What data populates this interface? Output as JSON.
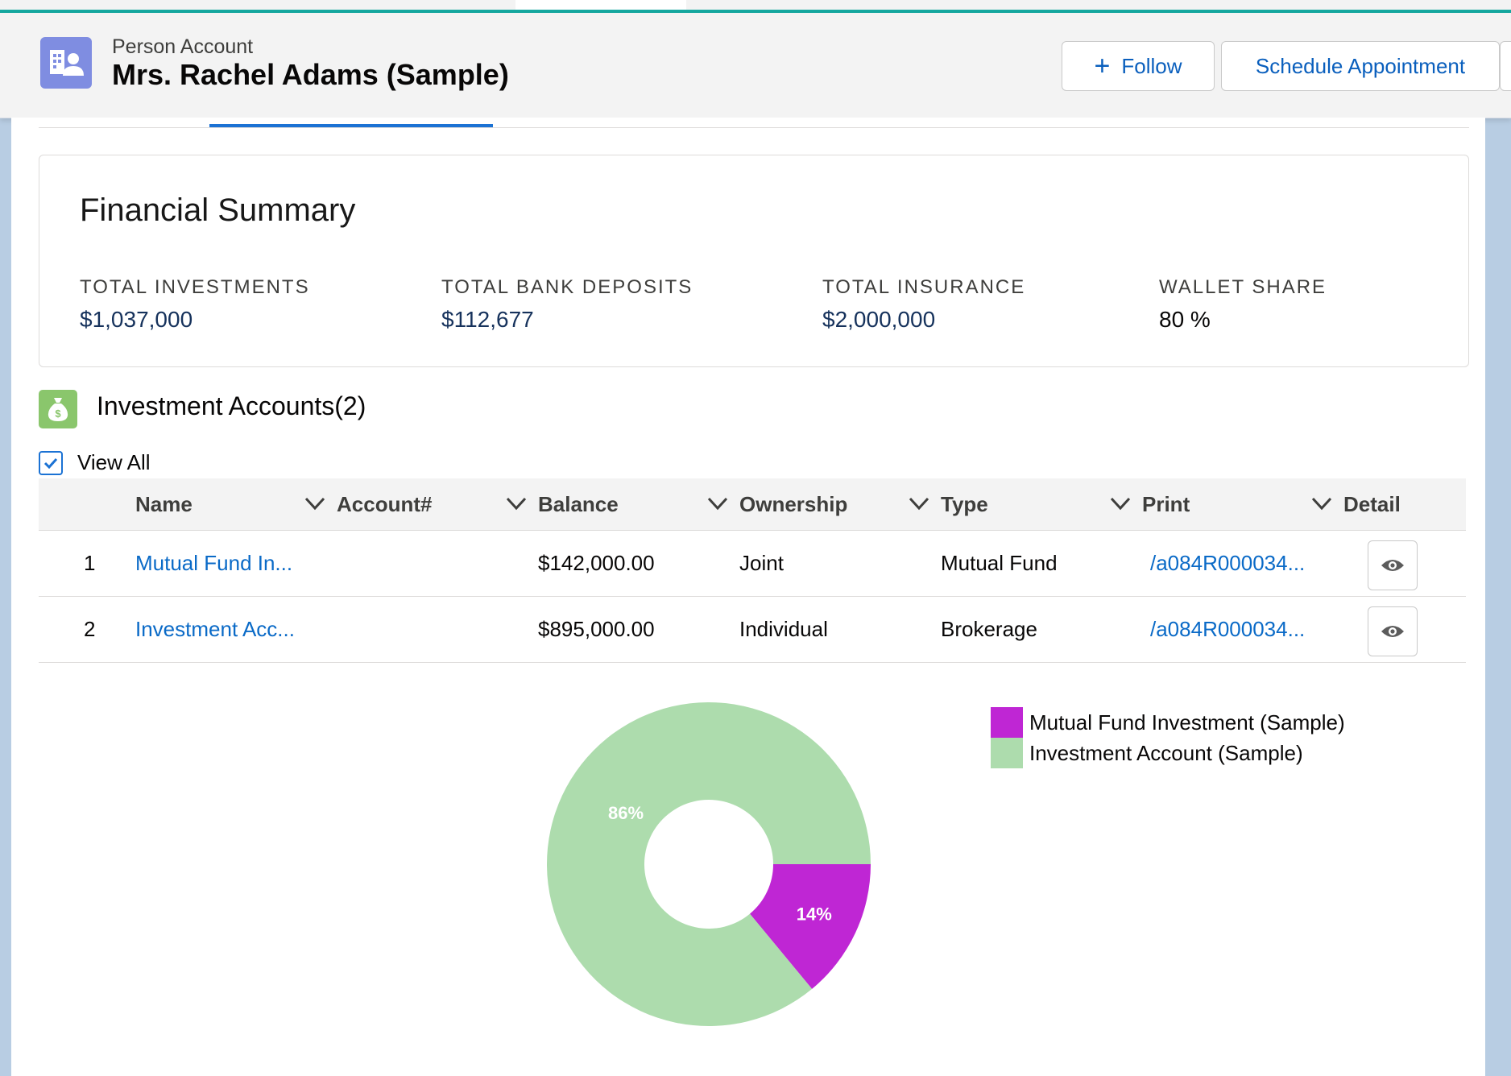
{
  "header": {
    "object_type": "Person Account",
    "record_name": "Mrs. Rachel Adams (Sample)",
    "follow_label": "Follow",
    "schedule_label": "Schedule Appointment",
    "icon": "person-account-icon"
  },
  "financial_summary": {
    "title": "Financial Summary",
    "metrics": [
      {
        "label": "TOTAL INVESTMENTS",
        "value": "$1,037,000"
      },
      {
        "label": "TOTAL BANK DEPOSITS",
        "value": "$112,677"
      },
      {
        "label": "TOTAL INSURANCE",
        "value": "$2,000,000"
      },
      {
        "label": "WALLET SHARE",
        "value": "80 %"
      }
    ]
  },
  "investment_accounts": {
    "title": "Investment Accounts(2)",
    "icon": "money-bag-icon",
    "view_all_label": "View All",
    "view_all_checked": true,
    "columns": [
      "Name",
      "Account#",
      "Balance",
      "Ownership",
      "Type",
      "Print",
      "Detail"
    ],
    "rows": [
      {
        "num": "1",
        "name": "Mutual Fund In...",
        "account": "",
        "balance": "$142,000.00",
        "ownership": "Joint",
        "type": "Mutual Fund",
        "print": "/a084R000034..."
      },
      {
        "num": "2",
        "name": "Investment Acc...",
        "account": "",
        "balance": "$895,000.00",
        "ownership": "Individual",
        "type": "Brokerage",
        "print": "/a084R000034..."
      }
    ]
  },
  "colors": {
    "accent": "#1b72d4",
    "link": "#0a6ac7",
    "slice_mutual": "#bf26d4",
    "slice_investment": "#addcad"
  },
  "chart_data": {
    "type": "pie",
    "donut": true,
    "categories": [
      "Mutual Fund Investment (Sample)",
      "Investment Account (Sample)"
    ],
    "values": [
      14,
      86
    ],
    "labels": [
      "14%",
      "86%"
    ],
    "colors": [
      "#bf26d4",
      "#addcad"
    ],
    "legend_position": "top-right"
  }
}
